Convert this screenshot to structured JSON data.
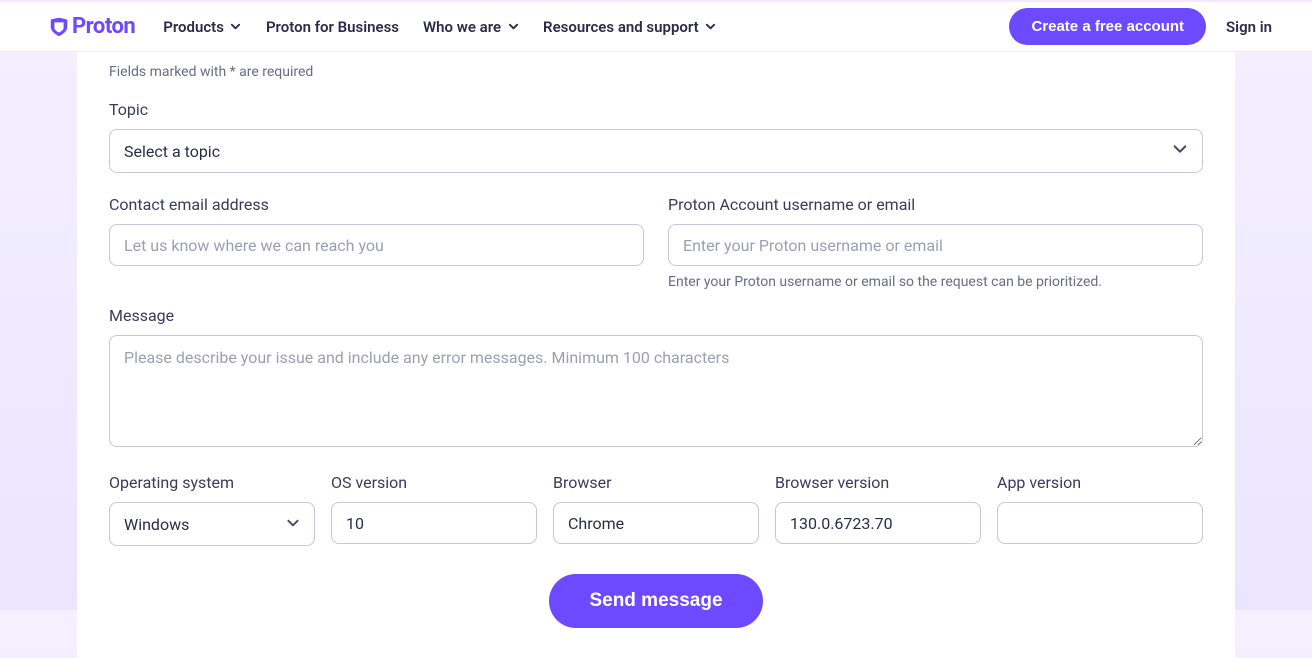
{
  "header": {
    "brand": "Proton",
    "nav": {
      "products": "Products",
      "business": "Proton for Business",
      "who": "Who we are",
      "resources": "Resources and support"
    },
    "cta": "Create a free account",
    "signin": "Sign in"
  },
  "form": {
    "required_hint": "Fields marked with * are required",
    "topic": {
      "label": "Topic",
      "placeholder": "Select a topic"
    },
    "contact_email": {
      "label": "Contact email address",
      "placeholder": "Let us know where we can reach you",
      "value": ""
    },
    "proton_account": {
      "label": "Proton Account username or email",
      "placeholder": "Enter your Proton username or email",
      "value": "",
      "helper": "Enter your Proton username or email so the request can be prioritized."
    },
    "message": {
      "label": "Message",
      "placeholder": "Please describe your issue and include any error messages. Minimum 100 characters",
      "value": ""
    },
    "os": {
      "label": "Operating system",
      "value": "Windows"
    },
    "os_version": {
      "label": "OS version",
      "value": "10"
    },
    "browser": {
      "label": "Browser",
      "value": "Chrome"
    },
    "browser_version": {
      "label": "Browser version",
      "value": "130.0.6723.70"
    },
    "app_version": {
      "label": "App version",
      "value": ""
    },
    "submit": "Send message"
  }
}
